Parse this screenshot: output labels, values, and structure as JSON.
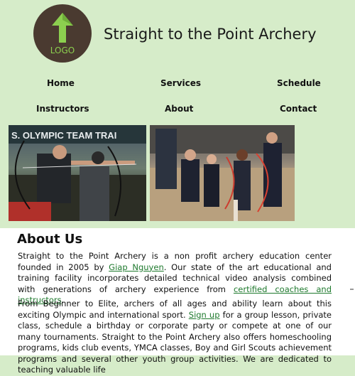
{
  "header": {
    "logo_text": "LOGO",
    "site_title": "Straight to the Point Archery"
  },
  "nav": {
    "home": "Home",
    "services": "Services",
    "schedule": "Schedule",
    "instructors": "Instructors",
    "about": "About",
    "contact": "Contact"
  },
  "photos": {
    "banner_text": "S. OLYMPIC TEAM TRAI"
  },
  "about": {
    "title": "About Us",
    "p1_a": "Straight to the Point Archery is a non profit archery education center founded in 2005 by ",
    "p1_link1": "Giap Nguyen",
    "p1_b": ". Our state of the art educational and training facility incorporates detailed technical video analysis combined with generations of archery experience from ",
    "p1_link2": "certified coaches and instructors",
    "p1_c": ".",
    "p2_a": "From Beginner to Elite, archers of all ages and ability learn about this exciting Olympic and international sport. ",
    "p2_link": "Sign up",
    "p2_b": " for a group lesson, private class, schedule a birthday or corporate party or compete at one of our many tournaments. Straight to the Point Archery also offers homeschooling programs, kids club events, YMCA classes, Boy and Girl Scouts achievement programs and several other youth group activities. We are dedicated to teaching valuable life"
  },
  "colors": {
    "page_background": "#d6ecc9",
    "logo_circle": "#4a3a30",
    "logo_accent": "#8ccf4f",
    "link": "#1f7a2e"
  }
}
